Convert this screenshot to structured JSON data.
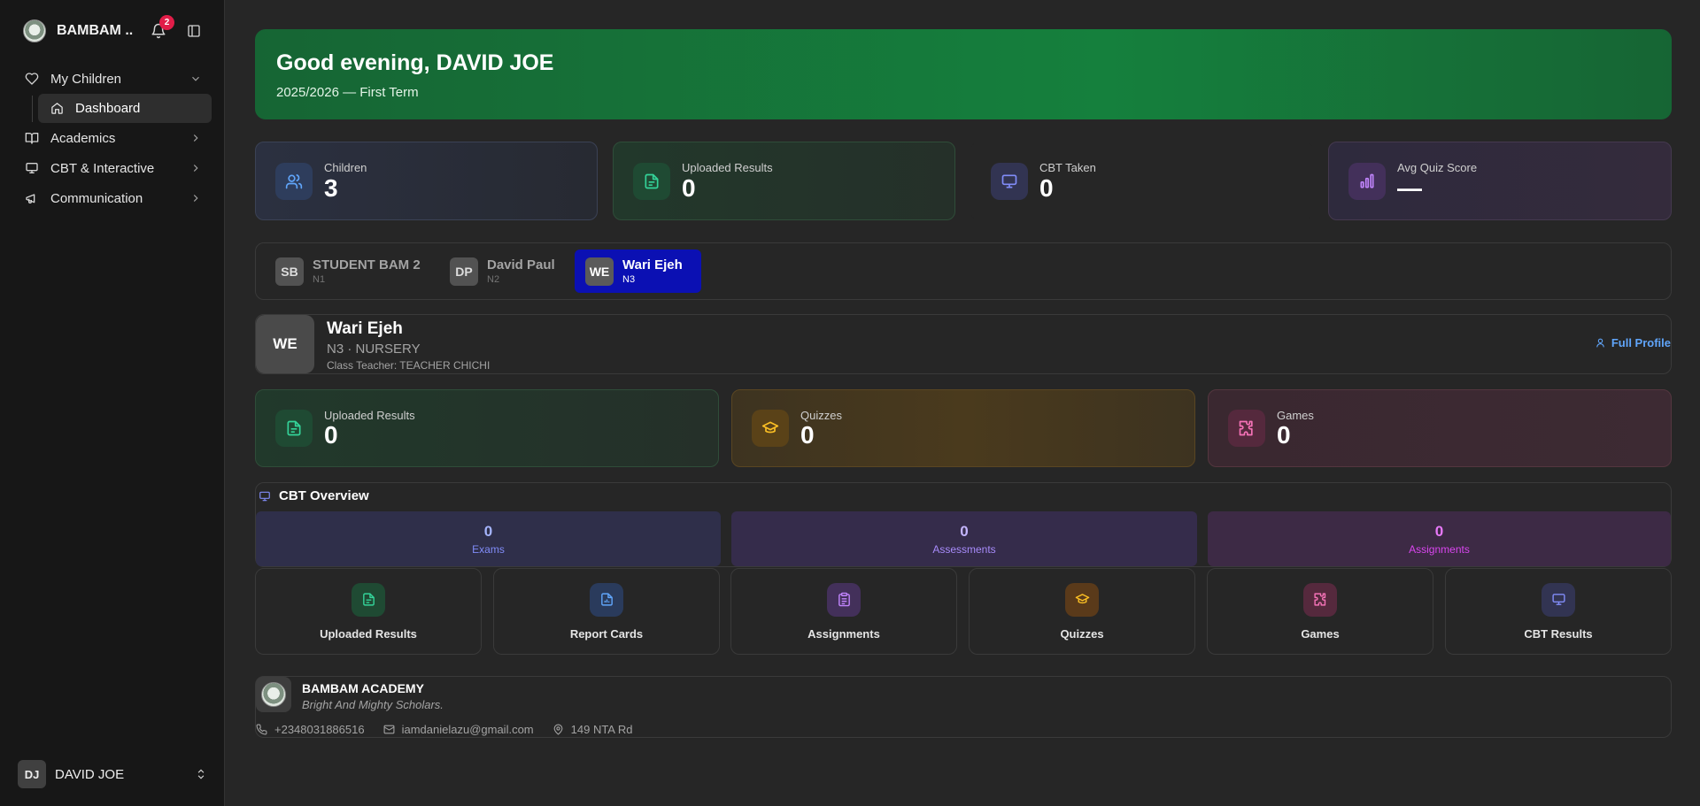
{
  "sidebar": {
    "brand_name": "BAMBAM ...",
    "notification_count": "2",
    "nav": {
      "my_children": "My Children",
      "dashboard": "Dashboard",
      "academics": "Academics",
      "cbt_interactive": "CBT & Interactive",
      "communication": "Communication"
    },
    "user": {
      "initials": "DJ",
      "name": "DAVID JOE"
    }
  },
  "hero": {
    "greeting": "Good evening, DAVID JOE",
    "term": "2025/2026 — First Term"
  },
  "stats": [
    {
      "label": "Children",
      "value": "3",
      "icon": "users-icon"
    },
    {
      "label": "Uploaded Results",
      "value": "0",
      "icon": "file-text-icon"
    },
    {
      "label": "CBT Taken",
      "value": "0",
      "icon": "monitor-icon"
    },
    {
      "label": "Avg Quiz Score",
      "value": "—",
      "icon": "bar-chart-icon"
    }
  ],
  "children": [
    {
      "initials": "SB",
      "name": "STUDENT BAM 2",
      "class": "N1"
    },
    {
      "initials": "DP",
      "name": "David Paul",
      "class": "N2"
    },
    {
      "initials": "WE",
      "name": "Wari Ejeh",
      "class": "N3"
    }
  ],
  "profile": {
    "initials": "WE",
    "name": "Wari Ejeh",
    "class_line": "N3 · NURSERY",
    "teacher": "Class Teacher: TEACHER CHICHI",
    "full_profile": "Full Profile"
  },
  "child_stats": [
    {
      "label": "Uploaded Results",
      "value": "0",
      "icon": "file-text-icon"
    },
    {
      "label": "Quizzes",
      "value": "0",
      "icon": "graduation-cap-icon"
    },
    {
      "label": "Games",
      "value": "0",
      "icon": "puzzle-icon"
    }
  ],
  "cbt_overview": {
    "title": "CBT Overview",
    "items": [
      {
        "count": "0",
        "label": "Exams"
      },
      {
        "count": "0",
        "label": "Assessments"
      },
      {
        "count": "0",
        "label": "Assignments"
      }
    ]
  },
  "quick_actions": [
    {
      "label": "Uploaded Results",
      "icon": "file-text-icon"
    },
    {
      "label": "Report Cards",
      "icon": "file-chart-icon"
    },
    {
      "label": "Assignments",
      "icon": "clipboard-icon"
    },
    {
      "label": "Quizzes",
      "icon": "graduation-cap-icon"
    },
    {
      "label": "Games",
      "icon": "puzzle-icon"
    },
    {
      "label": "CBT Results",
      "icon": "monitor-icon"
    }
  ],
  "school": {
    "name": "BAMBAM ACADEMY",
    "motto": "Bright And Mighty Scholars.",
    "phone": "+2348031886516",
    "email": "iamdanielazu@gmail.com",
    "address": "149 NTA Rd"
  },
  "colors": {
    "hero": "#15803d",
    "active_tab": "#0b10b3",
    "link": "#60a5fa",
    "badge": "#e11d48"
  }
}
